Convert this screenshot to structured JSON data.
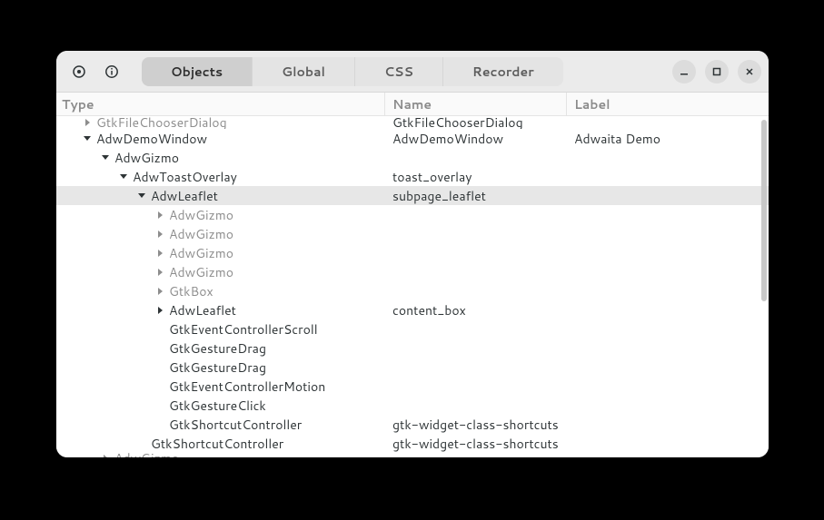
{
  "tabs": [
    "Objects",
    "Global",
    "CSS",
    "Recorder"
  ],
  "activeTab": 0,
  "columns": {
    "type": "Type",
    "name": "Name",
    "label": "Label"
  },
  "rows": [
    {
      "indent": 1,
      "expander": "right",
      "type": "GtkFileChooserDialog",
      "name": "GtkFileChooserDialog",
      "label": "",
      "dim": true,
      "clip": "top"
    },
    {
      "indent": 1,
      "expander": "down",
      "type": "AdwDemoWindow",
      "name": "AdwDemoWindow",
      "label": "Adwaita Demo"
    },
    {
      "indent": 2,
      "expander": "down",
      "type": "AdwGizmo",
      "name": "",
      "label": ""
    },
    {
      "indent": 3,
      "expander": "down",
      "type": "AdwToastOverlay",
      "name": "toast_overlay",
      "label": ""
    },
    {
      "indent": 4,
      "expander": "down",
      "type": "AdwLeaflet",
      "name": "subpage_leaflet",
      "label": "",
      "selected": true
    },
    {
      "indent": 5,
      "expander": "right",
      "type": "AdwGizmo",
      "name": "",
      "label": "",
      "dim": true
    },
    {
      "indent": 5,
      "expander": "right",
      "type": "AdwGizmo",
      "name": "",
      "label": "",
      "dim": true
    },
    {
      "indent": 5,
      "expander": "right",
      "type": "AdwGizmo",
      "name": "",
      "label": "",
      "dim": true
    },
    {
      "indent": 5,
      "expander": "right",
      "type": "AdwGizmo",
      "name": "",
      "label": "",
      "dim": true
    },
    {
      "indent": 5,
      "expander": "right",
      "type": "GtkBox",
      "name": "",
      "label": "",
      "dim": true
    },
    {
      "indent": 5,
      "expander": "right",
      "type": "AdwLeaflet",
      "name": "content_box",
      "label": ""
    },
    {
      "indent": 5,
      "expander": "none",
      "type": "GtkEventControllerScroll",
      "name": "",
      "label": ""
    },
    {
      "indent": 5,
      "expander": "none",
      "type": "GtkGestureDrag",
      "name": "",
      "label": ""
    },
    {
      "indent": 5,
      "expander": "none",
      "type": "GtkGestureDrag",
      "name": "",
      "label": ""
    },
    {
      "indent": 5,
      "expander": "none",
      "type": "GtkEventControllerMotion",
      "name": "",
      "label": ""
    },
    {
      "indent": 5,
      "expander": "none",
      "type": "GtkGestureClick",
      "name": "",
      "label": ""
    },
    {
      "indent": 5,
      "expander": "none",
      "type": "GtkShortcutController",
      "name": "gtk-widget-class-shortcuts",
      "label": ""
    },
    {
      "indent": 4,
      "expander": "none",
      "type": "GtkShortcutController",
      "name": "gtk-widget-class-shortcuts",
      "label": ""
    },
    {
      "indent": 2,
      "expander": "right",
      "type": "AdwGizmo",
      "name": "",
      "label": "",
      "dim": true,
      "clip": "bottom"
    }
  ]
}
